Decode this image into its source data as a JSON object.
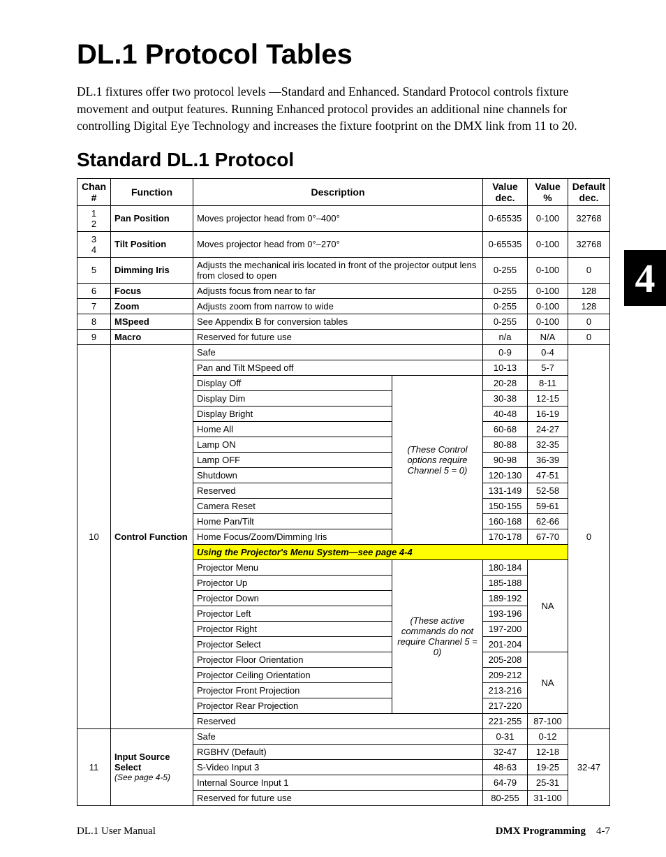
{
  "title": "DL.1 Protocol Tables",
  "intro": "DL.1 fixtures offer two protocol levels —Standard and Enhanced. Standard Protocol controls fixture movement and output features. Running Enhanced protocol provides an additional nine channels for controlling Digital Eye Technology and increases the fixture footprint on the DMX link from 11 to 20.",
  "subtitle": "Standard DL.1 Protocol",
  "tab": "4",
  "headers": {
    "chan": "Chan #",
    "func": "Function",
    "desc": "Description",
    "valdec": "Value dec.",
    "valpct": "Value %",
    "defdec": "Default dec."
  },
  "rows": {
    "r1": {
      "chan": "1\n2",
      "func": "Pan Position",
      "desc": "Moves projector head from 0°–400°",
      "vd": "0-65535",
      "vp": "0-100",
      "dd": "32768"
    },
    "r2": {
      "chan": "3\n4",
      "func": "Tilt Position",
      "desc": "Moves projector head from 0°–270°",
      "vd": "0-65535",
      "vp": "0-100",
      "dd": "32768"
    },
    "r3": {
      "chan": "5",
      "func": "Dimming Iris",
      "desc": "Adjusts the mechanical iris located in front of the projector output lens from closed to open",
      "vd": "0-255",
      "vp": "0-100",
      "dd": "0"
    },
    "r4": {
      "chan": "6",
      "func": "Focus",
      "desc": "Adjusts focus from near to far",
      "vd": "0-255",
      "vp": "0-100",
      "dd": "128"
    },
    "r5": {
      "chan": "7",
      "func": "Zoom",
      "desc": "Adjusts zoom from narrow to wide",
      "vd": "0-255",
      "vp": "0-100",
      "dd": "128"
    },
    "r6": {
      "chan": "8",
      "func": "MSpeed",
      "desc": "See Appendix B for conversion tables",
      "vd": "0-255",
      "vp": "0-100",
      "dd": "0"
    },
    "r7": {
      "chan": "9",
      "func": "Macro",
      "desc": "Reserved for future use",
      "vd": "n/a",
      "vp": "N/A",
      "dd": "0"
    }
  },
  "ch10": {
    "chan": "10",
    "func": "Control Function",
    "note1": "(These Control options require Channel  5 = 0)",
    "section_hdr": "Using the Projector's Menu System—see page 4-4",
    "note2": "(These active commands do not require Channel 5 = 0)",
    "dd": "0",
    "items": [
      {
        "d": "Safe",
        "vd": "0-9",
        "vp": "0-4"
      },
      {
        "d": "Pan and Tilt MSpeed off",
        "vd": "10-13",
        "vp": "5-7"
      },
      {
        "d": "Display Off",
        "vd": "20-28",
        "vp": "8-11"
      },
      {
        "d": "Display Dim",
        "vd": "30-38",
        "vp": "12-15"
      },
      {
        "d": "Display Bright",
        "vd": "40-48",
        "vp": "16-19"
      },
      {
        "d": "Home All",
        "vd": "60-68",
        "vp": "24-27"
      },
      {
        "d": "Lamp ON",
        "vd": "80-88",
        "vp": "32-35"
      },
      {
        "d": "Lamp OFF",
        "vd": "90-98",
        "vp": "36-39"
      },
      {
        "d": "Shutdown",
        "vd": "120-130",
        "vp": "47-51"
      },
      {
        "d": "Reserved",
        "vd": "131-149",
        "vp": "52-58"
      },
      {
        "d": "Camera Reset",
        "vd": "150-155",
        "vp": "59-61"
      },
      {
        "d": "Home Pan/Tilt",
        "vd": "160-168",
        "vp": "62-66"
      },
      {
        "d": "Home Focus/Zoom/Dimming Iris",
        "vd": "170-178",
        "vp": "67-70"
      }
    ],
    "proj": [
      {
        "d": "Projector Menu",
        "vd": "180-184"
      },
      {
        "d": "Projector Up",
        "vd": "185-188"
      },
      {
        "d": "Projector Down",
        "vd": "189-192"
      },
      {
        "d": "Projector Left",
        "vd": "193-196"
      },
      {
        "d": "Projector Right",
        "vd": "197-200"
      },
      {
        "d": "Projector Select",
        "vd": "201-204"
      },
      {
        "d": "Projector Floor Orientation",
        "vd": "205-208"
      },
      {
        "d": "Projector Ceiling Orientation",
        "vd": "209-212"
      },
      {
        "d": "Projector Front Projection",
        "vd": "213-216"
      },
      {
        "d": "Projector Rear Projection",
        "vd": "217-220"
      }
    ],
    "na": "NA",
    "reserved": {
      "d": "Reserved",
      "vd": "221-255",
      "vp": "87-100"
    }
  },
  "ch11": {
    "chan": "11",
    "func": "Input Source Select",
    "funcnote": "(See page 4-5)",
    "dd": "32-47",
    "items": [
      {
        "d": "Safe",
        "vd": "0-31",
        "vp": "0-12"
      },
      {
        "d": "RGBHV (Default)",
        "vd": "32-47",
        "vp": "12-18"
      },
      {
        "d": "S-Video Input 3",
        "vd": "48-63",
        "vp": "19-25"
      },
      {
        "d": "Internal Source Input 1",
        "vd": "64-79",
        "vp": "25-31"
      },
      {
        "d": "Reserved for future use",
        "vd": "80-255",
        "vp": "31-100"
      }
    ]
  },
  "footer": {
    "left": "DL.1 User Manual",
    "section": "DMX Programming",
    "page": "4-7"
  }
}
